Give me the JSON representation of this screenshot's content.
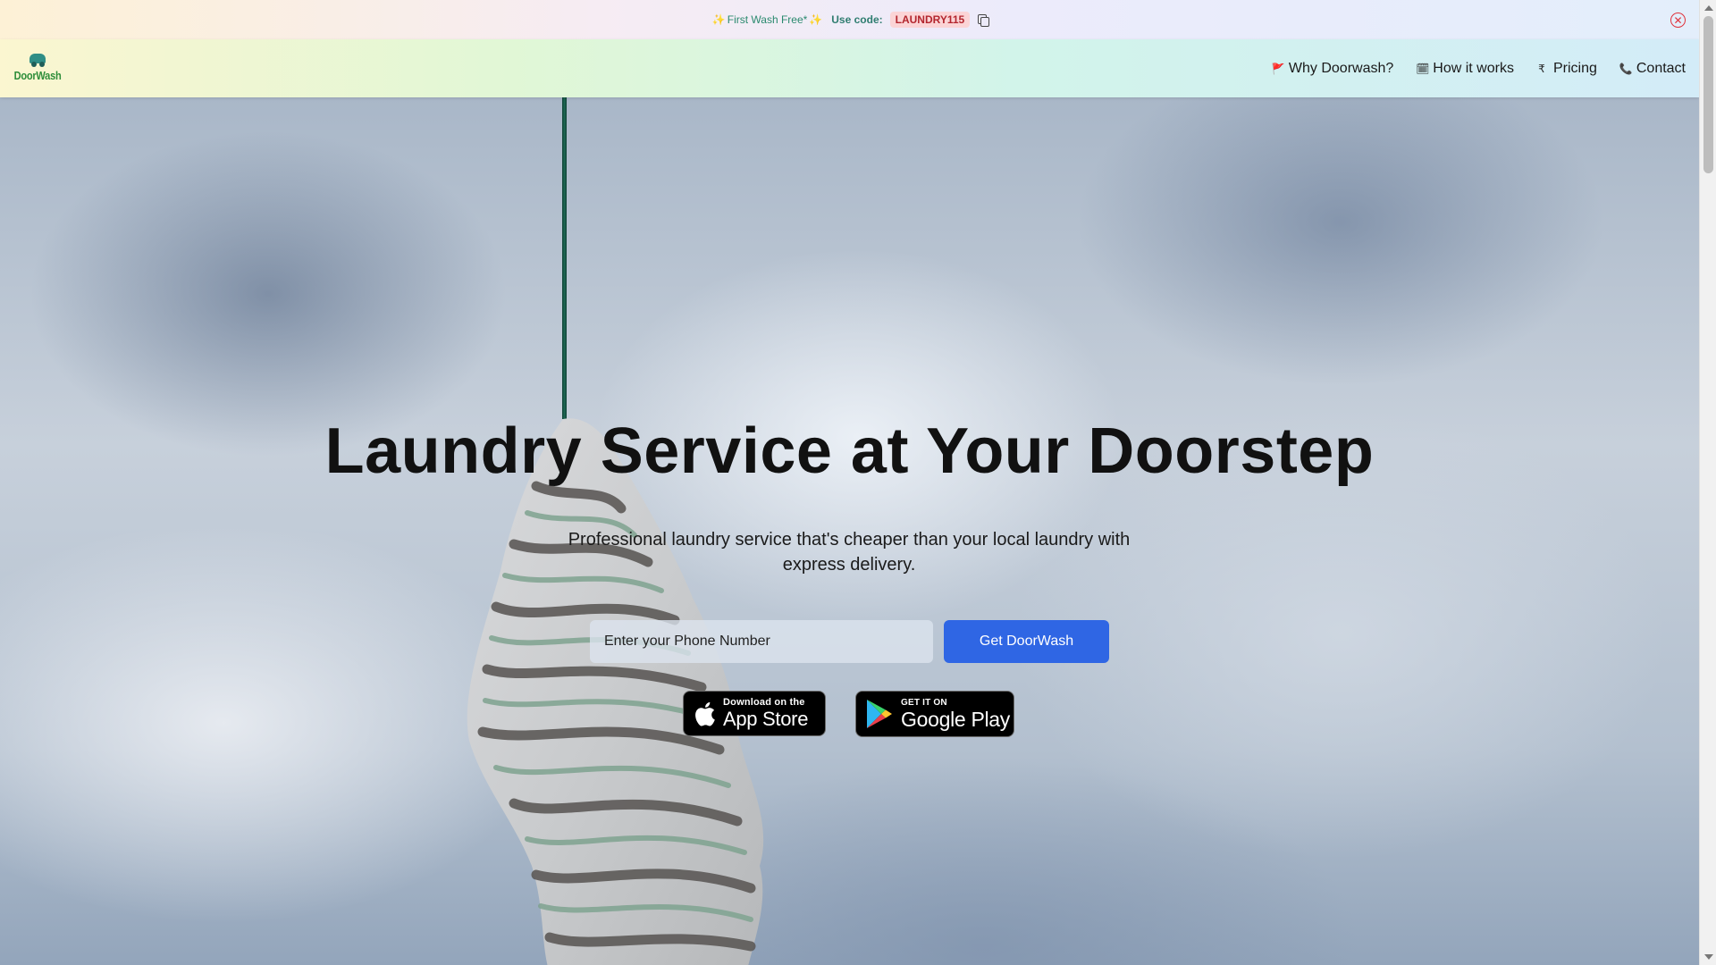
{
  "promo": {
    "sparkle_left": "✨",
    "offer": "First Wash Free*",
    "sparkle_right": "✨",
    "use_code_label": "Use code:",
    "code": "LAUNDRY115",
    "copy_icon": "copy-icon",
    "close_icon": "close-circle-icon"
  },
  "brand": {
    "name": "DoorWash"
  },
  "nav": {
    "items": [
      {
        "label": "Why Doorwash?",
        "icon": "🚩"
      },
      {
        "label": "How it works",
        "icon": "🗓"
      },
      {
        "label": "Pricing",
        "icon": "₹"
      },
      {
        "label": "Contact",
        "icon": "📞"
      }
    ]
  },
  "hero": {
    "title": "Laundry Service at Your Doorstep",
    "subtitle": "Professional laundry service that's cheaper than your local laundry with express delivery.",
    "phone_placeholder": "Enter your Phone Number",
    "cta_label": "Get DoorWash"
  },
  "stores": {
    "apple": {
      "small": "Download on the",
      "big": "App Store"
    },
    "google": {
      "small": "GET IT ON",
      "big": "Google Play"
    }
  },
  "colors": {
    "accent": "#2f66e4",
    "code_bg": "#fbd4d6",
    "code_text": "#b3262e",
    "brand_green": "#2e8e3a"
  }
}
